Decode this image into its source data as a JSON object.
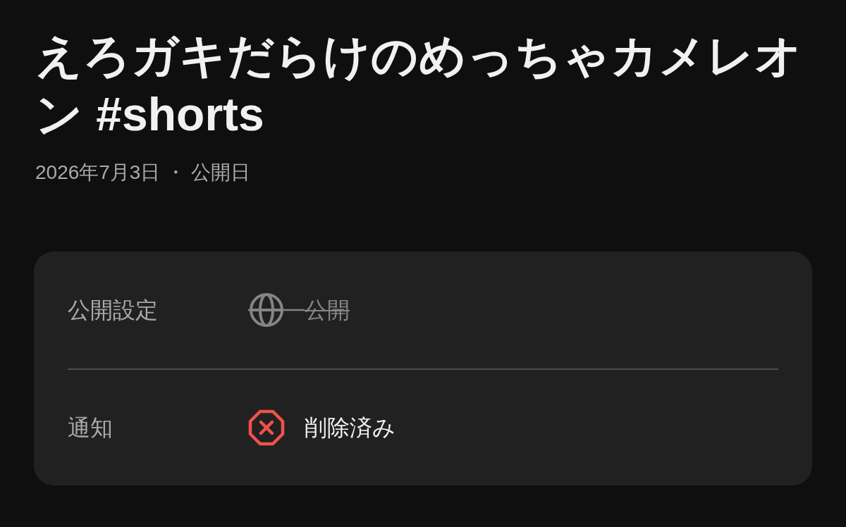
{
  "title": "えろガキだらけのめっちゃカメレオン #shorts",
  "published": "2026年7月3日 ・ 公開日",
  "details": [
    {
      "label": "公開設定",
      "value": "公開",
      "kind": "globe",
      "struck": true
    },
    {
      "label": "通知",
      "value": "削除済み",
      "kind": "deleted",
      "struck": false
    }
  ]
}
